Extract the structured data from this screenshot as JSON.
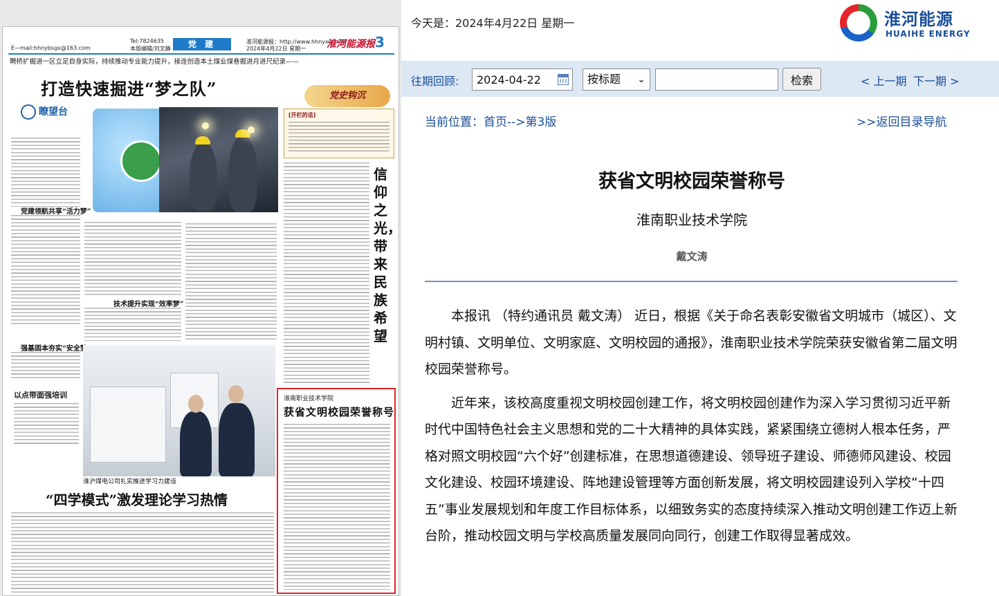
{
  "header": {
    "date_today": "今天是：2024年4月22日 星期一",
    "brand_cn": "淮河能源",
    "brand_en": "HUAIHE ENERGY"
  },
  "search": {
    "past_label": "往期回顾:",
    "date_value": "2024-04-22",
    "mode_selected": "按标题",
    "keyword_value": "",
    "search_label": "检索",
    "prev_label": "< 上一期",
    "next_label": "下一期 >"
  },
  "breadcrumb": {
    "text": "当前位置：首页-->第3版",
    "back_label": ">>返回目录导航"
  },
  "article": {
    "title": "获省文明校园荣誉称号",
    "subtitle": "淮南职业技术学院",
    "author": "戴文涛",
    "paragraphs": [
      "本报讯 （特约通讯员 戴文涛） 近日，根据《关于命名表彰安徽省文明城市（城区）、文明村镇、文明单位、文明家庭、文明校园的通报》，淮南职业技术学院荣获安徽省第二届文明校园荣誉称号。",
      "近年来，该校高度重视文明校园创建工作，将文明校园创建作为深入学习贯彻习近平新时代中国特色社会主义思想和党的二十大精神的具体实践，紧紧围绕立德树人根本任务，严格对照文明校园“六个好”创建标准，在思想道德建设、领导班子建设、师德师风建设、校园文化建设、校园环境建设、阵地建设管理等方面创新发展，将文明校园建设列入学校“十四五”事业发展规划和年度工作目标体系，以细致务实的态度持续深入推动文明创建工作迈上新台阶，推动校园文明与学校高质量发展同向同行，创建工作取得显著成效。"
    ]
  },
  "newspaper": {
    "email": "E—mail:hhnybsgx@163.com",
    "tel": "Tel:7824635",
    "editor": "本版编辑/刘文静",
    "section": "党 建",
    "website": "淮河能源报：http://www.hhnyxg.com",
    "date": "2024年4月22日 星期一",
    "logo": "淮河能源报",
    "page_number": "3",
    "lead": "聘桥扩掘进一区立足自身实际，持续推动专业能力提升，接连创造本土煤业煤巷掘进月进尺纪录——",
    "headline_1": "打造快速掘进“梦之队”",
    "column_name": "瞭望台",
    "history_logo": "党史钩沉",
    "sidebar_tag": "[开栏的话]",
    "vertical_title": "信仰之光，带来民族希望",
    "training_title": "以点带面强培训",
    "caption_2": "淮沪煤电公司扎实推进学习力建设",
    "headline_2": "“四学模式”激发理论学习热情",
    "highlight_source": "淮南职业技术学院",
    "highlight_title": "获省文明校园荣誉称号",
    "sub_heads": [
      "党建领航共享“活力梦”",
      "技术提升实现“效率梦”",
      "强基固本夯实“安全梦”"
    ]
  }
}
